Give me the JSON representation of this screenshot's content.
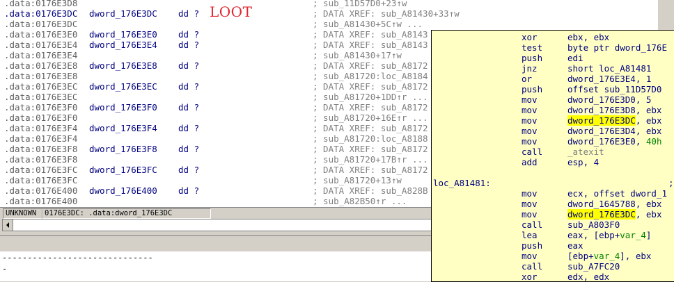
{
  "annotation": "LOOT",
  "rows": [
    {
      "addr": ".data:0176E3D8",
      "label": "",
      "dd": "",
      "cmt": "; sub_11D57D0+23↑w"
    },
    {
      "addr": ".data:0176E3DC",
      "label": "dword_176E3DC",
      "dd": "dd ?",
      "cmt": "; DATA XREF: sub_A81430+33↑w",
      "current": true
    },
    {
      "addr": ".data:0176E3DC",
      "label": "",
      "dd": "",
      "cmt": "; sub_A81430+5C↑w ..."
    },
    {
      "addr": ".data:0176E3E0",
      "label": "dword_176E3E0",
      "dd": "dd ?",
      "cmt": "; DATA XREF: sub_A8143"
    },
    {
      "addr": ".data:0176E3E4",
      "label": "dword_176E3E4",
      "dd": "dd ?",
      "cmt": "; DATA XREF: sub_A8143"
    },
    {
      "addr": ".data:0176E3E4",
      "label": "",
      "dd": "",
      "cmt": "; sub_A81430+17↑w"
    },
    {
      "addr": ".data:0176E3E8",
      "label": "dword_176E3E8",
      "dd": "dd ?",
      "cmt": "; DATA XREF: sub_A8172"
    },
    {
      "addr": ".data:0176E3E8",
      "label": "",
      "dd": "",
      "cmt": "; sub_A81720:loc_A8184"
    },
    {
      "addr": ".data:0176E3EC",
      "label": "dword_176E3EC",
      "dd": "dd ?",
      "cmt": "; DATA XREF: sub_A8172"
    },
    {
      "addr": ".data:0176E3EC",
      "label": "",
      "dd": "",
      "cmt": "; sub_A81720+1DD↑r ..."
    },
    {
      "addr": ".data:0176E3F0",
      "label": "dword_176E3F0",
      "dd": "dd ?",
      "cmt": "; DATA XREF: sub_A8172"
    },
    {
      "addr": ".data:0176E3F0",
      "label": "",
      "dd": "",
      "cmt": "; sub_A81720+16E↑r ..."
    },
    {
      "addr": ".data:0176E3F4",
      "label": "dword_176E3F4",
      "dd": "dd ?",
      "cmt": "; DATA XREF: sub_A8172"
    },
    {
      "addr": ".data:0176E3F4",
      "label": "",
      "dd": "",
      "cmt": "; sub_A81720:loc_A8188"
    },
    {
      "addr": ".data:0176E3F8",
      "label": "dword_176E3F8",
      "dd": "dd ?",
      "cmt": "; DATA XREF: sub_A8172"
    },
    {
      "addr": ".data:0176E3F8",
      "label": "",
      "dd": "",
      "cmt": "; sub_A81720+17B↑r ..."
    },
    {
      "addr": ".data:0176E3FC",
      "label": "dword_176E3FC",
      "dd": "dd ?",
      "cmt": "; DATA XREF: sub_A8172"
    },
    {
      "addr": ".data:0176E3FC",
      "label": "",
      "dd": "",
      "cmt": "; sub_A81720+13↑w"
    },
    {
      "addr": ".data:0176E400",
      "label": "dword_176E400",
      "dd": "dd ?",
      "cmt": "; DATA XREF: sub_A828B"
    },
    {
      "addr": ".data:0176E400",
      "label": "",
      "dd": "",
      "cmt": "; sub_A82B50↑r ..."
    }
  ],
  "status": {
    "mode": "UNKNOWN",
    "location": "0176E3DC: .data:dword_176E3DC"
  },
  "output": {
    "separator": "------------------------------",
    "line2": "-"
  },
  "popup": {
    "lines": [
      {
        "label": "",
        "mn": "xor",
        "op": "ebx, ebx"
      },
      {
        "label": "",
        "mn": "test",
        "op": "byte ptr dword_176E"
      },
      {
        "label": "",
        "mn": "push",
        "op": "edi"
      },
      {
        "label": "",
        "mn": "jnz",
        "op": "short loc_A81481"
      },
      {
        "label": "",
        "mn": "or",
        "op": "dword_176E3E4, 1"
      },
      {
        "label": "",
        "mn": "push",
        "op": "offset sub_11D57D0"
      },
      {
        "label": "",
        "mn": "mov",
        "op": "dword_176E3D0, 5"
      },
      {
        "label": "",
        "mn": "mov",
        "op": "dword_176E3D8, ebx"
      },
      {
        "label": "",
        "mn": "mov",
        "op_hl": "dword_176E3DC",
        "op_rest": ", ebx"
      },
      {
        "label": "",
        "mn": "mov",
        "op": "dword_176E3D4, ebx"
      },
      {
        "label": "",
        "mn": "mov",
        "op_pre": "dword_176E3E0, ",
        "op_green": "40h"
      },
      {
        "label": "",
        "mn": "call",
        "op_gray": "_atexit"
      },
      {
        "label": "",
        "mn": "add",
        "op": "esp, 4"
      },
      {
        "label": "",
        "mn": "",
        "op": ""
      },
      {
        "label": "loc_A81481:",
        "mn": "",
        "op": "",
        "cmt": "; C"
      },
      {
        "label": "",
        "mn": "mov",
        "op": "ecx, offset dword_1"
      },
      {
        "label": "",
        "mn": "mov",
        "op": "dword_1645788, ebx"
      },
      {
        "label": "",
        "mn": "mov",
        "op_hl": "dword_176E3DC",
        "op_rest": ", ebx"
      },
      {
        "label": "",
        "mn": "call",
        "op": "sub_A803F0"
      },
      {
        "label": "",
        "mn": "lea",
        "op_pre": "eax, [ebp+",
        "op_green": "var_4",
        "op_rest": "]"
      },
      {
        "label": "",
        "mn": "push",
        "op": "eax"
      },
      {
        "label": "",
        "mn": "mov",
        "op_pre": "[ebp+",
        "op_green": "var_4",
        "op_rest": "], ebx"
      },
      {
        "label": "",
        "mn": "call",
        "op": "sub_A7FC20"
      },
      {
        "label": "",
        "mn": "xor",
        "op": "edx, edx"
      }
    ]
  }
}
